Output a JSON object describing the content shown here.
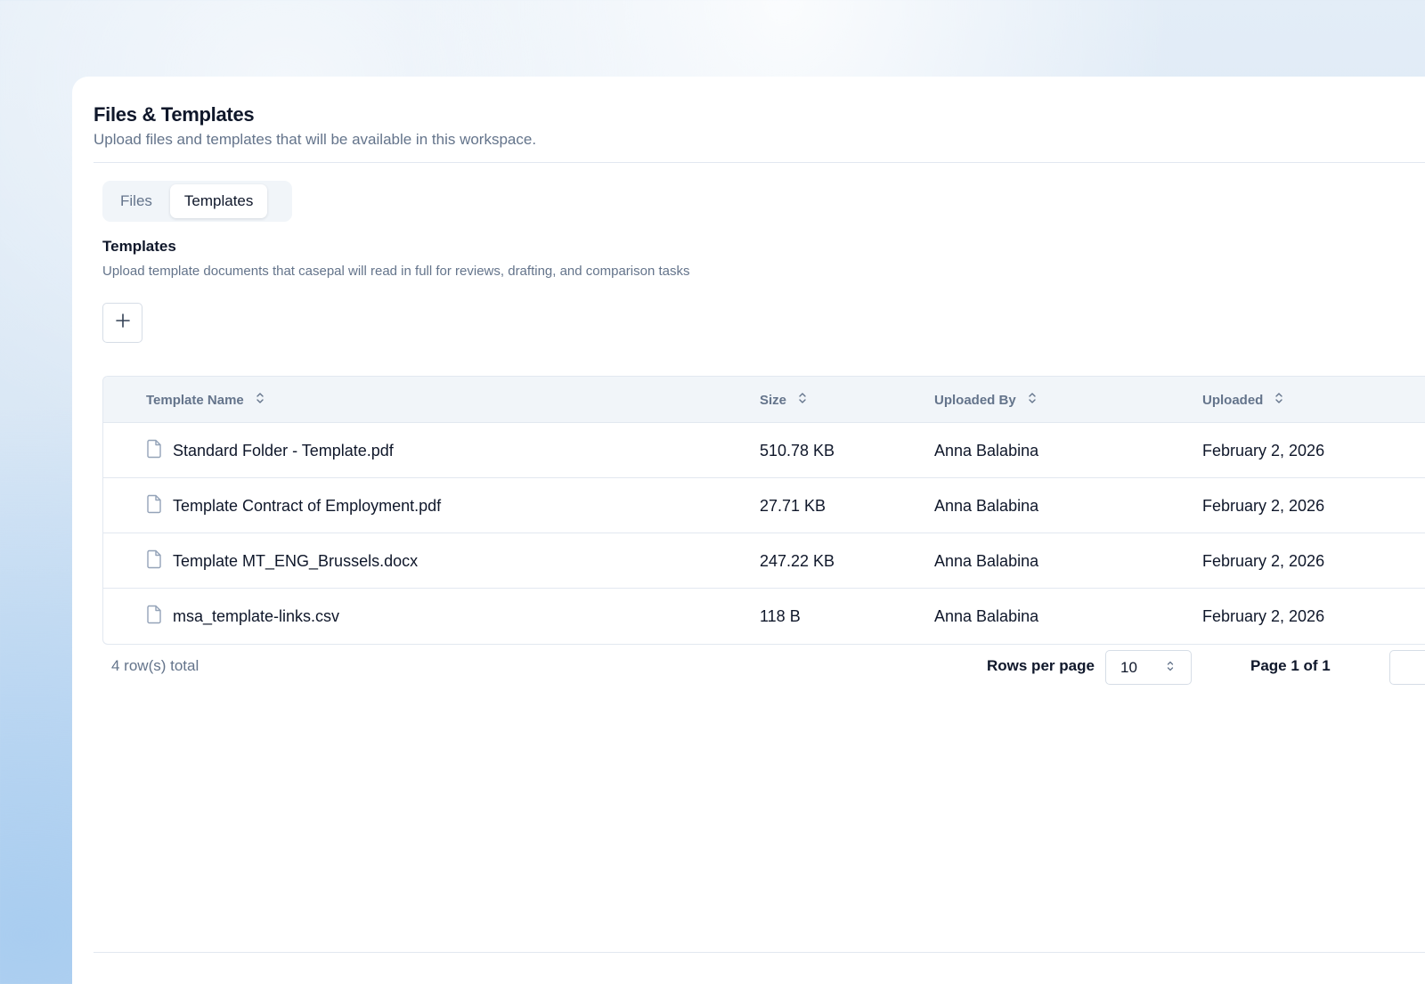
{
  "header": {
    "title": "Files & Templates",
    "subtitle": "Upload files and templates that will be available in this workspace."
  },
  "tabs": [
    {
      "label": "Files",
      "active": false
    },
    {
      "label": "Templates",
      "active": true
    }
  ],
  "section": {
    "title": "Templates",
    "description": "Upload template documents that casepal will read in full for reviews, drafting, and comparison tasks",
    "add_icon": "plus-icon"
  },
  "table": {
    "columns": [
      "Template Name",
      "Size",
      "Uploaded By",
      "Uploaded"
    ],
    "rows": [
      {
        "name": "Standard Folder - Template.pdf",
        "size": "510.78 KB",
        "uploaded_by": "Anna Balabina",
        "uploaded": "February 2, 2026"
      },
      {
        "name": "Template Contract of Employment.pdf",
        "size": "27.71 KB",
        "uploaded_by": "Anna Balabina",
        "uploaded": "February 2, 2026"
      },
      {
        "name": "Template MT_ENG_Brussels.docx",
        "size": "247.22 KB",
        "uploaded_by": "Anna Balabina",
        "uploaded": "February 2, 2026"
      },
      {
        "name": "msa_template-links.csv",
        "size": "118 B",
        "uploaded_by": "Anna Balabina",
        "uploaded": "February 2, 2026"
      }
    ]
  },
  "footer": {
    "total": "4 row(s) total",
    "rows_per_page_label": "Rows per page",
    "rows_per_page_value": "10",
    "page_info": "Page 1 of 1"
  },
  "colors": {
    "text_primary": "#0f172a",
    "text_muted": "#64748b",
    "header_bg": "#f1f5f9",
    "border": "#e2e8f0"
  }
}
